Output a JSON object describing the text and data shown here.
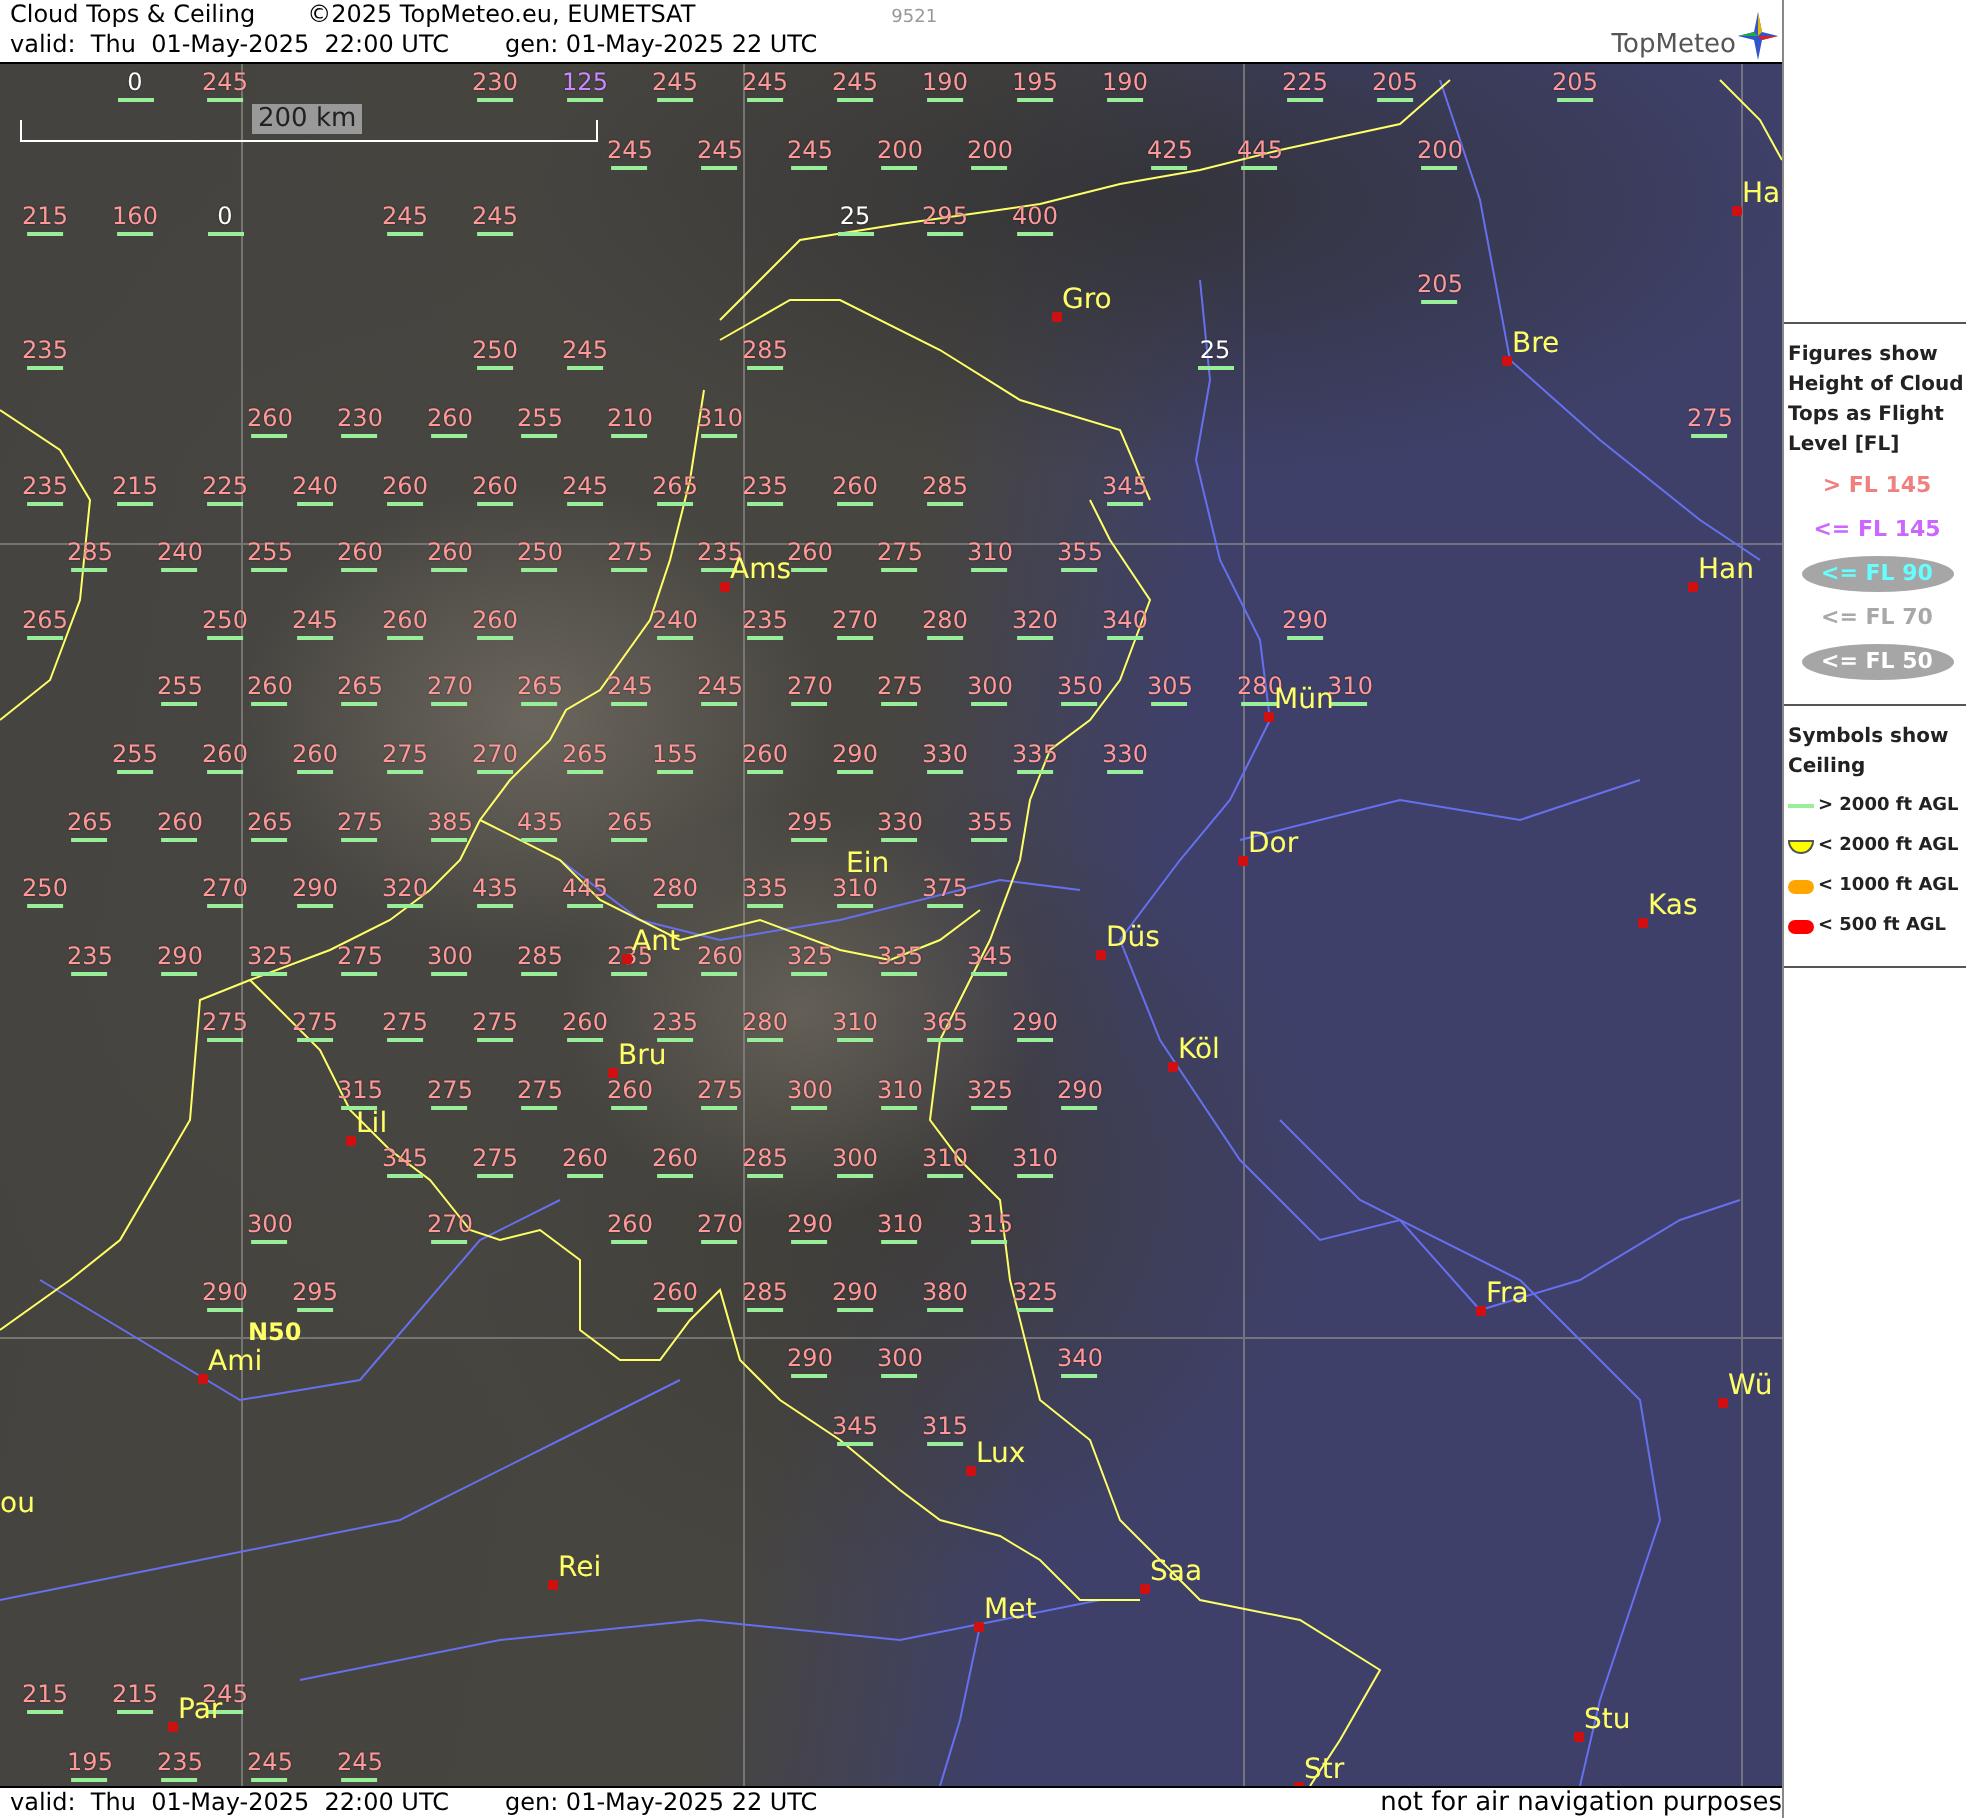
{
  "header": {
    "title": "Cloud Tops & Ceiling",
    "copyright": "©2025 TopMeteo.eu, EUMETSAT",
    "code": "9521",
    "valid": "valid:  Thu  01-May-2025  22:00 UTC",
    "generated": "gen: 01-May-2025 22 UTC",
    "logo": "TopMeteo"
  },
  "map": {
    "scale": "200 km",
    "grid_label": "N50",
    "cities": [
      {
        "name": "Gro"
      },
      {
        "name": "Ha"
      },
      {
        "name": "Bre"
      },
      {
        "name": "Han"
      },
      {
        "name": "Ams"
      },
      {
        "name": "Mün"
      },
      {
        "name": "Dor"
      },
      {
        "name": "Ein"
      },
      {
        "name": "Düs"
      },
      {
        "name": "Kas"
      },
      {
        "name": "Ant"
      },
      {
        "name": "Köl"
      },
      {
        "name": "Bru"
      },
      {
        "name": "Lil"
      },
      {
        "name": "Ami"
      },
      {
        "name": "Fra"
      },
      {
        "name": "Wü"
      },
      {
        "name": "Lux"
      },
      {
        "name": "ou"
      },
      {
        "name": "Rei"
      },
      {
        "name": "Saa"
      },
      {
        "name": "Met"
      },
      {
        "name": "Stu"
      },
      {
        "name": "Par"
      },
      {
        "name": "Str"
      }
    ],
    "cloud_tops": [
      {
        "value": "0",
        "color": "#ffffff",
        "kind": "high"
      },
      {
        "value": "245",
        "color": "#ff9999",
        "kind": "high"
      },
      {
        "value": "230",
        "color": "#ff9999",
        "kind": "high"
      },
      {
        "value": "125",
        "color": "#cc88ff",
        "kind": "high"
      },
      {
        "value": "245",
        "color": "#ff9999",
        "kind": "high"
      },
      {
        "value": "245",
        "color": "#ff9999",
        "kind": "high"
      },
      {
        "value": "245",
        "color": "#ff9999",
        "kind": "high"
      },
      {
        "value": "190",
        "color": "#ff9999",
        "kind": "high"
      },
      {
        "value": "195",
        "color": "#ff9999",
        "kind": "high"
      },
      {
        "value": "190",
        "color": "#ff9999",
        "kind": "high"
      },
      {
        "value": "225",
        "color": "#ff9999",
        "kind": "high"
      },
      {
        "value": "205",
        "color": "#ff9999",
        "kind": "high"
      },
      {
        "value": "205",
        "color": "#ff9999",
        "kind": "high"
      },
      {
        "value": "245",
        "color": "#ff9999",
        "kind": "high"
      },
      {
        "value": "245",
        "color": "#ff9999",
        "kind": "high"
      },
      {
        "value": "245",
        "color": "#ff9999",
        "kind": "high"
      },
      {
        "value": "200",
        "color": "#ff9999",
        "kind": "high"
      },
      {
        "value": "200",
        "color": "#ff9999",
        "kind": "high"
      },
      {
        "value": "425",
        "color": "#ff9999",
        "kind": "high"
      },
      {
        "value": "445",
        "color": "#ff9999",
        "kind": "high"
      },
      {
        "value": "200",
        "color": "#ff9999",
        "kind": "high"
      },
      {
        "value": "215",
        "color": "#ff9999",
        "kind": "high"
      },
      {
        "value": "160",
        "color": "#ff9999",
        "kind": "high"
      },
      {
        "value": "0",
        "color": "#ffffff",
        "kind": "high"
      },
      {
        "value": "245",
        "color": "#ff9999",
        "kind": "high"
      },
      {
        "value": "245",
        "color": "#ff9999",
        "kind": "high"
      },
      {
        "value": "25",
        "color": "#ffffff",
        "kind": "high"
      },
      {
        "value": "295",
        "color": "#ff9999",
        "kind": "high"
      },
      {
        "value": "400",
        "color": "#ff9999",
        "kind": "high"
      },
      {
        "value": "205",
        "color": "#ff9999",
        "kind": "high"
      },
      {
        "value": "235",
        "color": "#ff9999",
        "kind": "high"
      },
      {
        "value": "250",
        "color": "#ff9999",
        "kind": "high"
      },
      {
        "value": "245",
        "color": "#ff9999",
        "kind": "high"
      },
      {
        "value": "285",
        "color": "#ff9999",
        "kind": "high"
      },
      {
        "value": "25",
        "color": "#ffffff",
        "kind": "high"
      },
      {
        "value": "260",
        "color": "#ff9999",
        "kind": "high"
      },
      {
        "value": "230",
        "color": "#ff9999",
        "kind": "high"
      },
      {
        "value": "260",
        "color": "#ff9999",
        "kind": "high"
      },
      {
        "value": "255",
        "color": "#ff9999",
        "kind": "high"
      },
      {
        "value": "210",
        "color": "#ff9999",
        "kind": "high"
      },
      {
        "value": "310",
        "color": "#ff9999",
        "kind": "high"
      },
      {
        "value": "275",
        "color": "#ff9999",
        "kind": "high"
      },
      {
        "value": "235",
        "color": "#ff9999",
        "kind": "high"
      },
      {
        "value": "215",
        "color": "#ff9999",
        "kind": "high"
      },
      {
        "value": "225",
        "color": "#ff9999",
        "kind": "high"
      },
      {
        "value": "240",
        "color": "#ff9999",
        "kind": "high"
      },
      {
        "value": "260",
        "color": "#ff9999",
        "kind": "high"
      },
      {
        "value": "260",
        "color": "#ff9999",
        "kind": "high"
      },
      {
        "value": "245",
        "color": "#ff9999",
        "kind": "high"
      },
      {
        "value": "265",
        "color": "#ff9999",
        "kind": "high"
      },
      {
        "value": "235",
        "color": "#ff9999",
        "kind": "high"
      },
      {
        "value": "260",
        "color": "#ff9999",
        "kind": "high"
      },
      {
        "value": "285",
        "color": "#ff9999",
        "kind": "high"
      },
      {
        "value": "345",
        "color": "#ff9999",
        "kind": "high"
      },
      {
        "value": "285",
        "color": "#ff9999",
        "kind": "high"
      },
      {
        "value": "240",
        "color": "#ff9999",
        "kind": "high"
      },
      {
        "value": "255",
        "color": "#ff9999",
        "kind": "high"
      },
      {
        "value": "260",
        "color": "#ff9999",
        "kind": "high"
      },
      {
        "value": "260",
        "color": "#ff9999",
        "kind": "high"
      },
      {
        "value": "250",
        "color": "#ff9999",
        "kind": "high"
      },
      {
        "value": "275",
        "color": "#ff9999",
        "kind": "high"
      },
      {
        "value": "235",
        "color": "#ff9999",
        "kind": "high"
      },
      {
        "value": "260",
        "color": "#ff9999",
        "kind": "high"
      },
      {
        "value": "275",
        "color": "#ff9999",
        "kind": "high"
      },
      {
        "value": "310",
        "color": "#ff9999",
        "kind": "high"
      },
      {
        "value": "355",
        "color": "#ff9999",
        "kind": "high"
      },
      {
        "value": "265",
        "color": "#ff9999",
        "kind": "high"
      },
      {
        "value": "250",
        "color": "#ff9999",
        "kind": "high"
      },
      {
        "value": "245",
        "color": "#ff9999",
        "kind": "high"
      },
      {
        "value": "260",
        "color": "#ff9999",
        "kind": "high"
      },
      {
        "value": "260",
        "color": "#ff9999",
        "kind": "high"
      },
      {
        "value": "240",
        "color": "#ff9999",
        "kind": "high"
      },
      {
        "value": "235",
        "color": "#ff9999",
        "kind": "high"
      },
      {
        "value": "270",
        "color": "#ff9999",
        "kind": "high"
      },
      {
        "value": "280",
        "color": "#ff9999",
        "kind": "high"
      },
      {
        "value": "320",
        "color": "#ff9999",
        "kind": "high"
      },
      {
        "value": "340",
        "color": "#ff9999",
        "kind": "high"
      },
      {
        "value": "290",
        "color": "#ff9999",
        "kind": "high"
      },
      {
        "value": "255",
        "color": "#ff9999",
        "kind": "high"
      },
      {
        "value": "260",
        "color": "#ff9999",
        "kind": "high"
      },
      {
        "value": "265",
        "color": "#ff9999",
        "kind": "high"
      },
      {
        "value": "270",
        "color": "#ff9999",
        "kind": "high"
      },
      {
        "value": "265",
        "color": "#ff9999",
        "kind": "high"
      },
      {
        "value": "245",
        "color": "#ff9999",
        "kind": "high"
      },
      {
        "value": "245",
        "color": "#ff9999",
        "kind": "high"
      },
      {
        "value": "270",
        "color": "#ff9999",
        "kind": "high"
      },
      {
        "value": "275",
        "color": "#ff9999",
        "kind": "high"
      },
      {
        "value": "300",
        "color": "#ff9999",
        "kind": "high"
      },
      {
        "value": "350",
        "color": "#ff9999",
        "kind": "high"
      },
      {
        "value": "305",
        "color": "#ff9999",
        "kind": "high"
      },
      {
        "value": "280",
        "color": "#ff9999",
        "kind": "high"
      },
      {
        "value": "310",
        "color": "#ff9999",
        "kind": "high"
      },
      {
        "value": "255",
        "color": "#ff9999",
        "kind": "high"
      },
      {
        "value": "260",
        "color": "#ff9999",
        "kind": "high"
      },
      {
        "value": "260",
        "color": "#ff9999",
        "kind": "high"
      },
      {
        "value": "275",
        "color": "#ff9999",
        "kind": "high"
      },
      {
        "value": "270",
        "color": "#ff9999",
        "kind": "high"
      },
      {
        "value": "265",
        "color": "#ff9999",
        "kind": "high"
      },
      {
        "value": "155",
        "color": "#ff9999",
        "kind": "high"
      },
      {
        "value": "260",
        "color": "#ff9999",
        "kind": "high"
      },
      {
        "value": "290",
        "color": "#ff9999",
        "kind": "high"
      },
      {
        "value": "330",
        "color": "#ff9999",
        "kind": "high"
      },
      {
        "value": "335",
        "color": "#ff9999",
        "kind": "high"
      },
      {
        "value": "330",
        "color": "#ff9999",
        "kind": "high"
      },
      {
        "value": "265",
        "color": "#ff9999",
        "kind": "high"
      },
      {
        "value": "260",
        "color": "#ff9999",
        "kind": "high"
      },
      {
        "value": "265",
        "color": "#ff9999",
        "kind": "high"
      },
      {
        "value": "275",
        "color": "#ff9999",
        "kind": "high"
      },
      {
        "value": "385",
        "color": "#ff9999",
        "kind": "high"
      },
      {
        "value": "435",
        "color": "#ff9999",
        "kind": "high"
      },
      {
        "value": "265",
        "color": "#ff9999",
        "kind": "high"
      },
      {
        "value": "295",
        "color": "#ff9999",
        "kind": "high"
      },
      {
        "value": "330",
        "color": "#ff9999",
        "kind": "high"
      },
      {
        "value": "355",
        "color": "#ff9999",
        "kind": "high"
      },
      {
        "value": "250",
        "color": "#ff9999",
        "kind": "high"
      },
      {
        "value": "270",
        "color": "#ff9999",
        "kind": "high"
      },
      {
        "value": "290",
        "color": "#ff9999",
        "kind": "high"
      },
      {
        "value": "320",
        "color": "#ff9999",
        "kind": "high"
      },
      {
        "value": "435",
        "color": "#ff9999",
        "kind": "high"
      },
      {
        "value": "445",
        "color": "#ff9999",
        "kind": "high"
      },
      {
        "value": "280",
        "color": "#ff9999",
        "kind": "high"
      },
      {
        "value": "335",
        "color": "#ff9999",
        "kind": "high"
      },
      {
        "value": "310",
        "color": "#ff9999",
        "kind": "high"
      },
      {
        "value": "375",
        "color": "#ff9999",
        "kind": "high"
      },
      {
        "value": "235",
        "color": "#ff9999",
        "kind": "high"
      },
      {
        "value": "290",
        "color": "#ff9999",
        "kind": "high"
      },
      {
        "value": "325",
        "color": "#ff9999",
        "kind": "high"
      },
      {
        "value": "275",
        "color": "#ff9999",
        "kind": "high"
      },
      {
        "value": "300",
        "color": "#ff9999",
        "kind": "high"
      },
      {
        "value": "285",
        "color": "#ff9999",
        "kind": "high"
      },
      {
        "value": "235",
        "color": "#ff9999",
        "kind": "high"
      },
      {
        "value": "260",
        "color": "#ff9999",
        "kind": "high"
      },
      {
        "value": "325",
        "color": "#ff9999",
        "kind": "high"
      },
      {
        "value": "335",
        "color": "#ff9999",
        "kind": "high"
      },
      {
        "value": "345",
        "color": "#ff9999",
        "kind": "high"
      },
      {
        "value": "275",
        "color": "#ff9999",
        "kind": "high"
      },
      {
        "value": "275",
        "color": "#ff9999",
        "kind": "high"
      },
      {
        "value": "275",
        "color": "#ff9999",
        "kind": "high"
      },
      {
        "value": "275",
        "color": "#ff9999",
        "kind": "high"
      },
      {
        "value": "260",
        "color": "#ff9999",
        "kind": "high"
      },
      {
        "value": "235",
        "color": "#ff9999",
        "kind": "high"
      },
      {
        "value": "280",
        "color": "#ff9999",
        "kind": "high"
      },
      {
        "value": "310",
        "color": "#ff9999",
        "kind": "high"
      },
      {
        "value": "365",
        "color": "#ff9999",
        "kind": "high"
      },
      {
        "value": "290",
        "color": "#ff9999",
        "kind": "high"
      },
      {
        "value": "315",
        "color": "#ff9999",
        "kind": "high"
      },
      {
        "value": "275",
        "color": "#ff9999",
        "kind": "high"
      },
      {
        "value": "275",
        "color": "#ff9999",
        "kind": "high"
      },
      {
        "value": "260",
        "color": "#ff9999",
        "kind": "high"
      },
      {
        "value": "275",
        "color": "#ff9999",
        "kind": "high"
      },
      {
        "value": "300",
        "color": "#ff9999",
        "kind": "high"
      },
      {
        "value": "310",
        "color": "#ff9999",
        "kind": "high"
      },
      {
        "value": "325",
        "color": "#ff9999",
        "kind": "high"
      },
      {
        "value": "290",
        "color": "#ff9999",
        "kind": "high"
      },
      {
        "value": "345",
        "color": "#ff9999",
        "kind": "high"
      },
      {
        "value": "275",
        "color": "#ff9999",
        "kind": "high"
      },
      {
        "value": "260",
        "color": "#ff9999",
        "kind": "high"
      },
      {
        "value": "260",
        "color": "#ff9999",
        "kind": "high"
      },
      {
        "value": "285",
        "color": "#ff9999",
        "kind": "high"
      },
      {
        "value": "300",
        "color": "#ff9999",
        "kind": "high"
      },
      {
        "value": "310",
        "color": "#ff9999",
        "kind": "high"
      },
      {
        "value": "310",
        "color": "#ff9999",
        "kind": "high"
      },
      {
        "value": "300",
        "color": "#ff9999",
        "kind": "high"
      },
      {
        "value": "270",
        "color": "#ff9999",
        "kind": "high"
      },
      {
        "value": "260",
        "color": "#ff9999",
        "kind": "high"
      },
      {
        "value": "270",
        "color": "#ff9999",
        "kind": "high"
      },
      {
        "value": "290",
        "color": "#ff9999",
        "kind": "high"
      },
      {
        "value": "310",
        "color": "#ff9999",
        "kind": "high"
      },
      {
        "value": "315",
        "color": "#ff9999",
        "kind": "high"
      },
      {
        "value": "290",
        "color": "#ff9999",
        "kind": "high"
      },
      {
        "value": "295",
        "color": "#ff9999",
        "kind": "high"
      },
      {
        "value": "260",
        "color": "#ff9999",
        "kind": "high"
      },
      {
        "value": "285",
        "color": "#ff9999",
        "kind": "high"
      },
      {
        "value": "290",
        "color": "#ff9999",
        "kind": "high"
      },
      {
        "value": "380",
        "color": "#ff9999",
        "kind": "high"
      },
      {
        "value": "325",
        "color": "#ff9999",
        "kind": "high"
      },
      {
        "value": "290",
        "color": "#ff9999",
        "kind": "high"
      },
      {
        "value": "300",
        "color": "#ff9999",
        "kind": "high"
      },
      {
        "value": "340",
        "color": "#ff9999",
        "kind": "high"
      },
      {
        "value": "345",
        "color": "#ff9999",
        "kind": "high"
      },
      {
        "value": "315",
        "color": "#ff9999",
        "kind": "high"
      },
      {
        "value": "215",
        "color": "#ff9999",
        "kind": "high"
      },
      {
        "value": "215",
        "color": "#ff9999",
        "kind": "high"
      },
      {
        "value": "245",
        "color": "#ff9999",
        "kind": "high"
      },
      {
        "value": "195",
        "color": "#ff9999",
        "kind": "high"
      },
      {
        "value": "235",
        "color": "#ff9999",
        "kind": "high"
      },
      {
        "value": "245",
        "color": "#ff9999",
        "kind": "high"
      },
      {
        "value": "245",
        "color": "#ff9999",
        "kind": "high"
      }
    ]
  },
  "legend": {
    "tops_title": "Figures show Height of Cloud Tops as Flight Level  [FL]",
    "tops": [
      {
        "label": "> FL 145",
        "color": "#f08080",
        "kind": "plain"
      },
      {
        "label": "<= FL 145",
        "color": "#cc66ff",
        "kind": "plain"
      },
      {
        "label": "<= FL 90",
        "color": "#66ffff",
        "kind": "ellipse"
      },
      {
        "label": "<= FL 70",
        "color": "#a8a8a8",
        "kind": "plain"
      },
      {
        "label": "<= FL 50",
        "color": "#ffffff",
        "kind": "ellipse"
      }
    ],
    "ceiling_title": "Symbols show Ceiling",
    "ceiling": [
      {
        "label": "> 2000 ft AGL",
        "kind": "line",
        "color": "#99ee99"
      },
      {
        "label": "< 2000 ft AGL",
        "kind": "bowl",
        "color": "#ffff00"
      },
      {
        "label": "< 1000 ft AGL",
        "kind": "pill",
        "color": "#ffa500"
      },
      {
        "label": "< 500 ft AGL",
        "kind": "pill",
        "color": "#ff0000"
      }
    ]
  },
  "footer": {
    "valid": "valid:  Thu  01-May-2025  22:00 UTC",
    "generated": "gen: 01-May-2025 22 UTC",
    "disclaimer": "not for air navigation purposes"
  }
}
